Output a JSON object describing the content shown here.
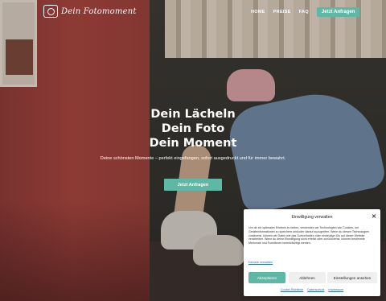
{
  "header": {
    "logo_text": "Dein Fotomoment",
    "nav": [
      "HOME",
      "PREISE",
      "FAQ"
    ],
    "cta": "Jetzt Anfragen"
  },
  "hero": {
    "headline_1": "Dein Lächeln",
    "headline_2": "Dein Foto",
    "headline_3": "Dein Moment",
    "subtitle": "Deine schönsten Momente – perfekt eingefangen, sofort ausgedruckt und für immer bewahrt.",
    "cta": "Jetzt Anfragen"
  },
  "cookie": {
    "title": "Einwilligung verwalten",
    "body": "Um dir ein optimales Erlebnis zu bieten, verwenden wir Technologien wie Cookies, um Geräteinformationen zu speichern und/oder darauf zuzugreifen. Wenn du diesen Technologien zustimmst, können wir Daten wie das Surfverhalten oder eindeutige IDs auf dieser Website verarbeiten. Wenn du deine Einwilligung nicht erteilst oder zurückziehst, können bestimmte Merkmale und Funktionen beeinträchtigt werden.",
    "details_link": "Dienste verwalten",
    "accept": "Akzeptieren",
    "reject": "Ablehnen",
    "settings": "Einstellungen ansehen",
    "footer": [
      "Cookie-Richtlinie",
      "Datenschutz",
      "Impressum"
    ]
  },
  "colors": {
    "accent": "#5fb8a5",
    "link": "#2a6fb0"
  }
}
